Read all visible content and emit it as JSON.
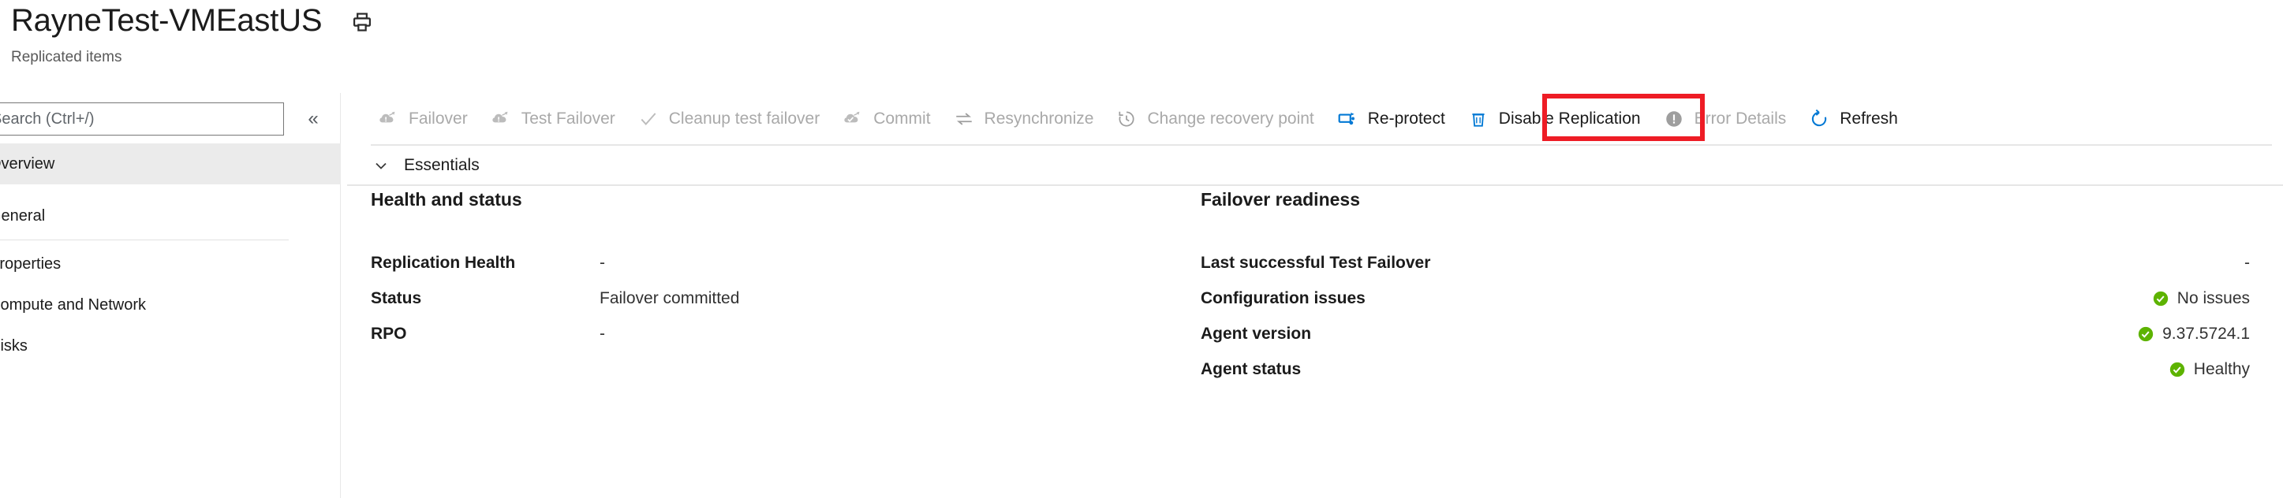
{
  "header": {
    "title": "RayneTest-VMEastUS",
    "subtitle": "Replicated items",
    "print_icon": "printer-icon"
  },
  "sidebar": {
    "search": {
      "placeholder": "Search (Ctrl+/)",
      "value": ""
    },
    "collapse_label": "«",
    "items": [
      {
        "label": "Overview",
        "selected": true,
        "type": "item"
      },
      {
        "label": "General",
        "selected": false,
        "type": "section"
      },
      {
        "label": "Properties",
        "selected": false,
        "type": "item"
      },
      {
        "label": "Compute and Network",
        "selected": false,
        "type": "item"
      },
      {
        "label": "Disks",
        "selected": false,
        "type": "item"
      }
    ]
  },
  "toolbar": {
    "items": [
      {
        "label": "Failover",
        "icon": "failover-icon",
        "enabled": false,
        "highlighted": false
      },
      {
        "label": "Test Failover",
        "icon": "test-failover-icon",
        "enabled": false,
        "highlighted": false
      },
      {
        "label": "Cleanup test failover",
        "icon": "checkmark-icon",
        "enabled": false,
        "highlighted": false
      },
      {
        "label": "Commit",
        "icon": "commit-icon",
        "enabled": false,
        "highlighted": false
      },
      {
        "label": "Resynchronize",
        "icon": "resynchronize-icon",
        "enabled": false,
        "highlighted": false
      },
      {
        "label": "Change recovery point",
        "icon": "clock-history-icon",
        "enabled": false,
        "highlighted": false
      },
      {
        "label": "Re-protect",
        "icon": "re-protect-icon",
        "enabled": true,
        "highlighted": true
      },
      {
        "label": "Disable Replication",
        "icon": "trash-icon",
        "enabled": true,
        "highlighted": false
      },
      {
        "label": "Error Details",
        "icon": "error-icon",
        "enabled": false,
        "highlighted": false
      },
      {
        "label": "Refresh",
        "icon": "refresh-icon",
        "enabled": true,
        "highlighted": false
      }
    ],
    "highlight_color": "#ee1c25"
  },
  "essentials": {
    "label": "Essentials",
    "chevron_icon": "chevron-down-icon",
    "expanded": true
  },
  "health_and_status": {
    "heading": "Health and status",
    "rows": [
      {
        "key": "Replication Health",
        "value": "-",
        "status": null
      },
      {
        "key": "Status",
        "value": "Failover committed",
        "status": null
      },
      {
        "key": "RPO",
        "value": "-",
        "status": null
      }
    ]
  },
  "failover_readiness": {
    "heading": "Failover readiness",
    "rows": [
      {
        "key": "Last successful Test Failover",
        "value": "-",
        "status": null
      },
      {
        "key": "Configuration issues",
        "value": "No issues",
        "status": "ok"
      },
      {
        "key": "Agent version",
        "value": "9.37.5724.1",
        "status": "ok"
      },
      {
        "key": "Agent status",
        "value": "Healthy",
        "status": "ok"
      }
    ]
  },
  "colors": {
    "accent_blue": "#0078d4",
    "status_green": "#5db300",
    "disabled_grey": "#a9a9a9",
    "text_primary": "#1b1b1b",
    "selected_bg": "#ebebeb"
  }
}
